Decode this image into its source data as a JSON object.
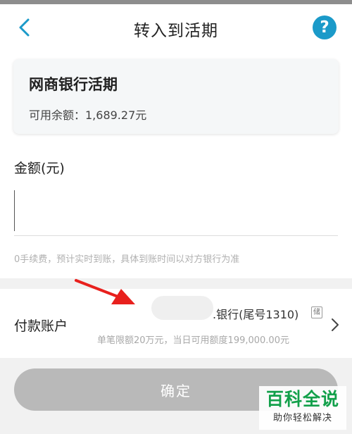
{
  "header": {
    "title": "转入到活期",
    "help_label": "?"
  },
  "icons": {
    "back": "chevron-left-icon",
    "help": "question-mark-icon",
    "next": "chevron-right-icon",
    "annotation": "red-arrow-icon"
  },
  "account_card": {
    "name": "网商银行活期",
    "balance": "可用余额：1,689.27元"
  },
  "amount": {
    "label": "金额(元)",
    "value": "",
    "placeholder": ""
  },
  "fee_note": "0手续费，预计实时到账，具体到账时间以对方银行为准",
  "payment": {
    "label": "付款账户",
    "account": ".银行(尾号1310)",
    "badge": "储",
    "limit": "单笔限额20万元，当日可用额度199,000.00元"
  },
  "confirm_label": "确定",
  "watermark": {
    "title": "百科全说",
    "subtitle": "助你轻松解决"
  },
  "colors": {
    "accent": "#1b9ac9",
    "disabled_button": "#b9b9b9",
    "annotation_arrow": "#e8201d",
    "watermark_green": "#12a04a"
  }
}
